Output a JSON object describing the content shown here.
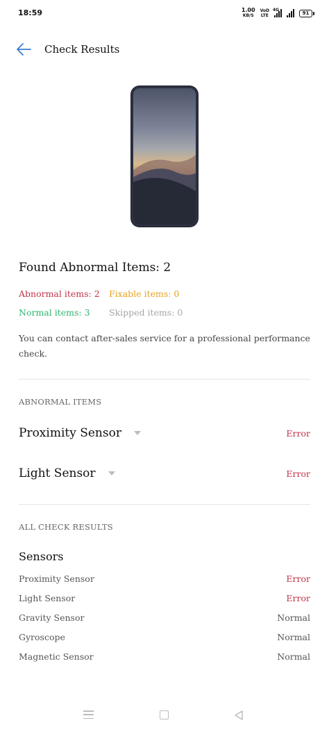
{
  "status": {
    "time": "18:59",
    "speed_value": "1.00",
    "speed_unit": "KB/S",
    "volte_top": "VoD",
    "volte_bottom": "LTE",
    "net_type": "4G",
    "battery": "91"
  },
  "header": {
    "title": "Check Results",
    "back_icon": "back-arrow-icon"
  },
  "summary": {
    "heading": "Found Abnormal Items: 2",
    "abnormal": "Abnormal items: 2",
    "fixable": "Fixable items: 0",
    "normal": "Normal items: 3",
    "skipped": "Skipped items: 0",
    "description": "You can contact after-sales service for a professional performance check."
  },
  "abnormal_section": {
    "label": "ABNORMAL ITEMS",
    "items": [
      {
        "name": "Proximity Sensor",
        "status": "Error"
      },
      {
        "name": "Light Sensor",
        "status": "Error"
      }
    ]
  },
  "all_section": {
    "label": "ALL CHECK RESULTS",
    "group": "Sensors",
    "items": [
      {
        "name": "Proximity Sensor",
        "status": "Error"
      },
      {
        "name": "Light Sensor",
        "status": "Error"
      },
      {
        "name": "Gravity Sensor",
        "status": "Normal"
      },
      {
        "name": "Gyroscope",
        "status": "Normal"
      },
      {
        "name": "Magnetic Sensor",
        "status": "Normal"
      }
    ]
  },
  "colors": {
    "error": "#c0344a",
    "fixable": "#e8a21b",
    "normal": "#2fb56f",
    "skipped": "#a6a6a6",
    "accent": "#3a7bd5"
  }
}
